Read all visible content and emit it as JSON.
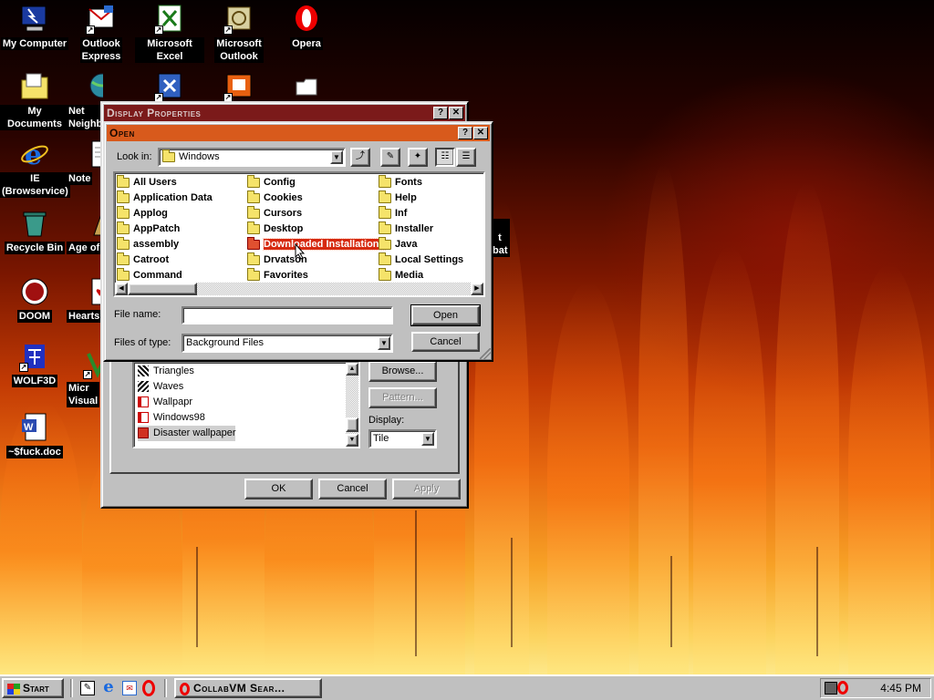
{
  "desktop": {
    "icons": [
      {
        "label": "My Computer",
        "icon": "my-computer-icon"
      },
      {
        "label": "Outlook\nExpress",
        "icon": "outlook-express-icon"
      },
      {
        "label": "Microsoft Excel",
        "icon": "excel-icon"
      },
      {
        "label": "Microsoft\nOutlook",
        "icon": "outlook-icon"
      },
      {
        "label": "Opera",
        "icon": "opera-icon"
      },
      {
        "label": "My Documents",
        "icon": "my-documents-icon"
      },
      {
        "label": "Net\nNeighb",
        "icon": "network-icon"
      },
      {
        "label": "IE\n(Browservice)",
        "icon": "ie-icon"
      },
      {
        "label": "Note",
        "icon": "notepad-icon"
      },
      {
        "label": "Recycle Bin",
        "icon": "recycle-bin-icon"
      },
      {
        "label": "Age of",
        "icon": "age-of-empires-icon"
      },
      {
        "label": "DOOM",
        "icon": "doom-icon"
      },
      {
        "label": "Hearts",
        "icon": "hearts-icon"
      },
      {
        "label": "WOLF3D",
        "icon": "wolf3d-icon"
      },
      {
        "label": "Micr\nVisual",
        "icon": "visual-basic-icon"
      },
      {
        "label": "~$fuck.doc",
        "icon": "word-doc-icon"
      },
      {
        "label": "t\nbat",
        "icon": "bat-file-icon"
      }
    ]
  },
  "display_properties": {
    "title": "Display Properties",
    "wallpaper_list": [
      "Triangles",
      "Waves",
      "Wallpapr",
      "Windows98",
      "Disaster wallpaper"
    ],
    "browse_label": "Browse...",
    "pattern_label": "Pattern...",
    "display_label": "Display:",
    "display_value": "Tile",
    "ok_label": "OK",
    "cancel_label": "Cancel",
    "apply_label": "Apply"
  },
  "open_dialog": {
    "title": "Open",
    "look_in_label": "Look in:",
    "look_in_value": "Windows",
    "folders": [
      [
        "All Users",
        "Application Data",
        "Applog",
        "AppPatch",
        "assembly",
        "Catroot",
        "Command"
      ],
      [
        "Config",
        "Cookies",
        "Cursors",
        "Desktop",
        "Downloaded Installations",
        "Drvatson",
        "Favorites"
      ],
      [
        "Fonts",
        "Help",
        "Inf",
        "Installer",
        "Java",
        "Local Settings",
        "Media"
      ]
    ],
    "selected_folder": "Downloaded Installations",
    "file_name_label": "File name:",
    "file_name_value": "",
    "files_of_type_label": "Files of type:",
    "files_of_type_value": "Background Files",
    "open_label": "Open",
    "cancel_label": "Cancel"
  },
  "taskbar": {
    "start_label": "Start",
    "task_label": "CollabVM Sear...",
    "clock": "4:45 PM"
  },
  "colors": {
    "title_active": "#d85a1c",
    "title_inactive": "#7b1a1a",
    "selection": "#d62a10"
  }
}
